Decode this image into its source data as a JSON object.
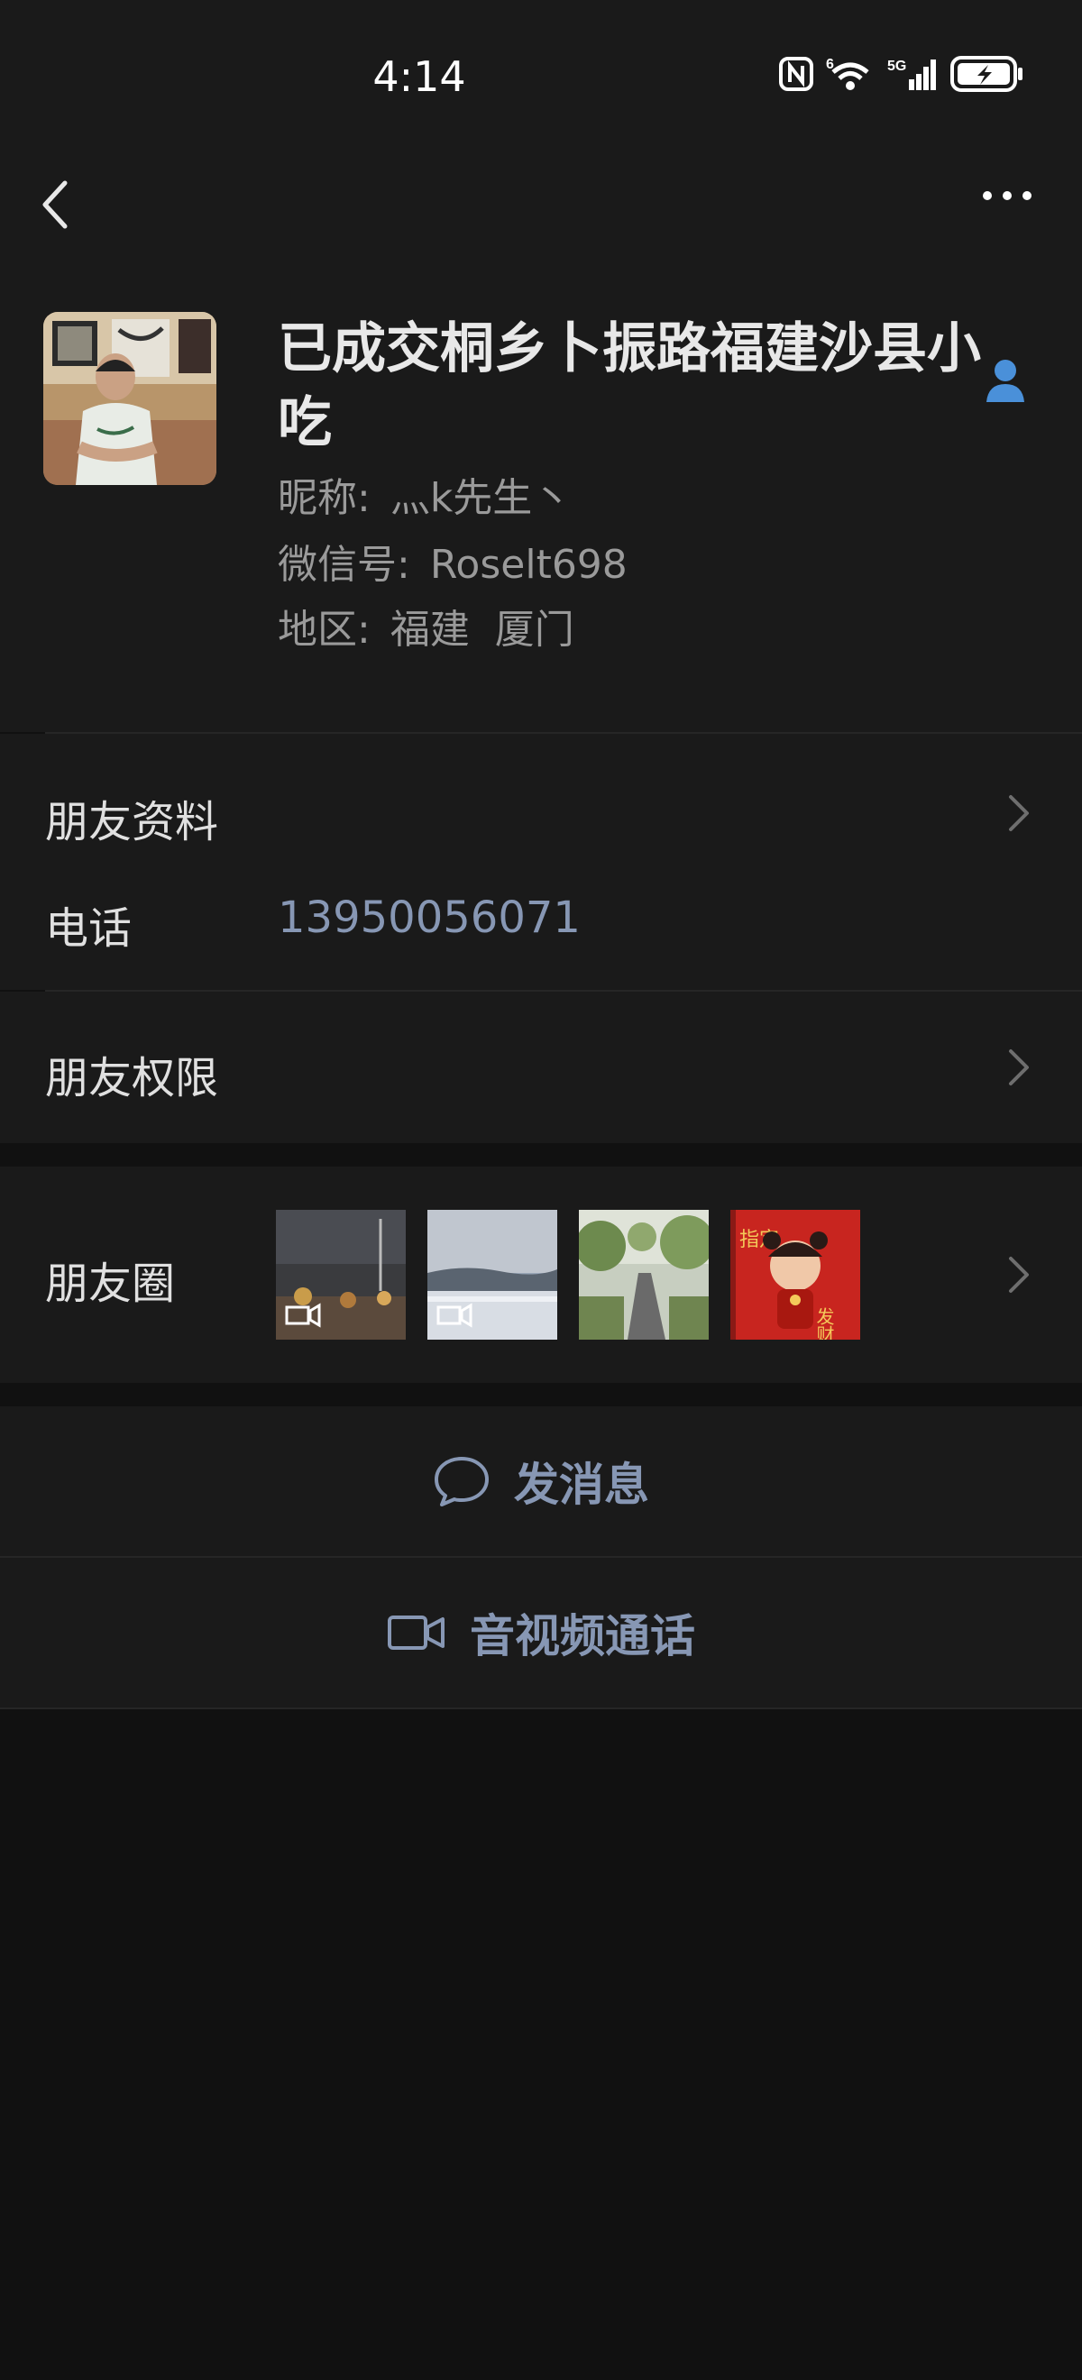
{
  "status_bar": {
    "time": "4:14",
    "signal_text": "5G",
    "wifi_text": "6"
  },
  "profile": {
    "display_name": "已成交桐乡卜振路福建沙县小吃",
    "nickname_label": "昵称:",
    "nickname_value": "灬k先生丶",
    "wechat_id_label": "微信号:",
    "wechat_id_value": "Roselt698",
    "region_label": "地区:",
    "region_value": "福建  厦门"
  },
  "rows": {
    "friend_info": "朋友资料",
    "phone_label": "电话",
    "phone_value": "13950056071",
    "friend_permissions": "朋友权限",
    "moments_label": "朋友圈"
  },
  "thumb_text": {
    "badge_left": "指定",
    "badge_right": "发财"
  },
  "actions": {
    "send_message": "发消息",
    "av_call": "音视频通话"
  },
  "colors": {
    "accent": "#8797b4",
    "contact_icon": "#4a90d9",
    "background": "#111111",
    "card": "#1a1a1a"
  },
  "icons": [
    "back-arrow-icon",
    "more-icon",
    "contact-icon",
    "chevron-right-icon",
    "chat-bubble-icon",
    "video-camera-icon"
  ]
}
